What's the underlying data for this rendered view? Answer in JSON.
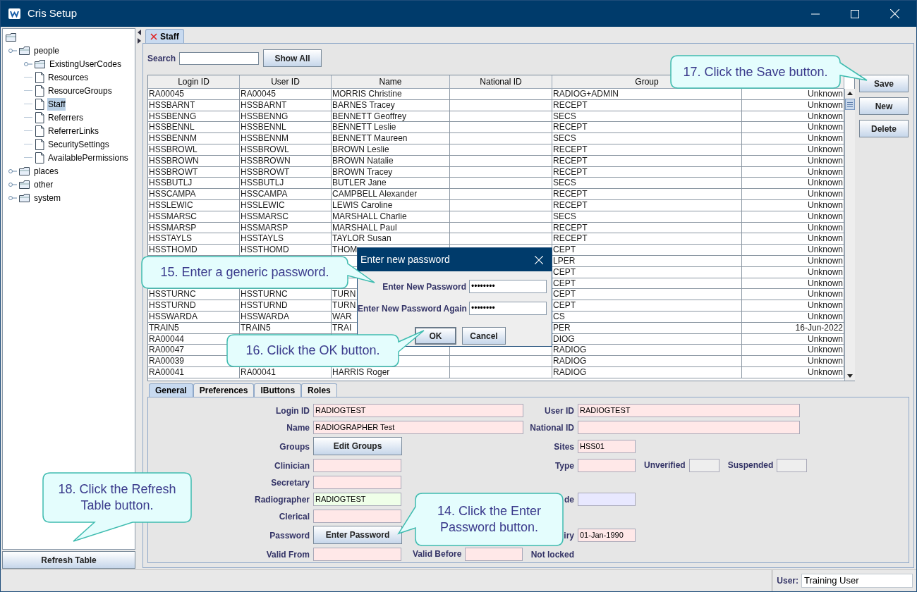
{
  "window": {
    "title": "Cris Setup"
  },
  "tree": {
    "kind": "folder",
    "children": [
      {
        "label": "people",
        "kind": "folder",
        "selected": false,
        "children": [
          {
            "label": "ExistingUserCodes",
            "kind": "folder",
            "selected": false
          },
          {
            "label": "Resources",
            "kind": "document",
            "selected": false
          },
          {
            "label": "ResourceGroups",
            "kind": "document",
            "selected": false
          },
          {
            "label": "Staff",
            "kind": "document",
            "selected": true
          },
          {
            "label": "Referrers",
            "kind": "document",
            "selected": false
          },
          {
            "label": "ReferrerLinks",
            "kind": "document",
            "selected": false
          },
          {
            "label": "SecuritySettings",
            "kind": "document",
            "selected": false
          },
          {
            "label": "AvailablePermissions",
            "kind": "document",
            "selected": false
          }
        ]
      },
      {
        "label": "places",
        "kind": "folder",
        "selected": false
      },
      {
        "label": "other",
        "kind": "folder",
        "selected": false
      },
      {
        "label": "system",
        "kind": "folder",
        "selected": false
      }
    ]
  },
  "refresh_button": "Refresh Table",
  "tabs": [
    {
      "label": "Staff",
      "selected": true
    }
  ],
  "search": {
    "label": "Search",
    "button": "Show All"
  },
  "table": {
    "columns": [
      {
        "label": "Login ID"
      },
      {
        "label": "User ID"
      },
      {
        "label": "Name"
      },
      {
        "label": "National ID"
      },
      {
        "label": "Group"
      }
    ],
    "rows": [
      {
        "login_id": "RA00045",
        "user_id": "RA00045",
        "name": "MORRIS Christine",
        "group": "RADIOG+ADMIN",
        "column_6": "Unknown"
      },
      {
        "login_id": "HSSBARNT",
        "user_id": "HSSBARNT",
        "name": "BARNES Tracey",
        "group": "RECEPT",
        "column_6": "Unknown"
      },
      {
        "login_id": "HSSBENNG",
        "user_id": "HSSBENNG",
        "name": "BENNETT Geoffrey",
        "group": "SECS",
        "column_6": "Unknown"
      },
      {
        "login_id": "HSSBENNL",
        "user_id": "HSSBENNL",
        "name": "BENNETT Leslie",
        "group": "RECEPT",
        "column_6": "Unknown"
      },
      {
        "login_id": "HSSBENNM",
        "user_id": "HSSBENNM",
        "name": "BENNETT Maureen",
        "group": "SECS",
        "column_6": "Unknown"
      },
      {
        "login_id": "HSSBROWL",
        "user_id": "HSSBROWL",
        "name": "BROWN Leslie",
        "group": "RECEPT",
        "column_6": "Unknown"
      },
      {
        "login_id": "HSSBROWN",
        "user_id": "HSSBROWN",
        "name": "BROWN Natalie",
        "group": "RECEPT",
        "column_6": "Unknown"
      },
      {
        "login_id": "HSSBROWT",
        "user_id": "HSSBROWT",
        "name": "BROWN Tracey",
        "group": "RECEPT",
        "column_6": "Unknown"
      },
      {
        "login_id": "HSSBUTLJ",
        "user_id": "HSSBUTLJ",
        "name": "BUTLER Jane",
        "group": "SECS",
        "column_6": "Unknown"
      },
      {
        "login_id": "HSSCAMPA",
        "user_id": "HSSCAMPA",
        "name": "CAMPBELL Alexander",
        "group": "RECEPT",
        "column_6": "Unknown"
      },
      {
        "login_id": "HSSLEWIC",
        "user_id": "HSSLEWIC",
        "name": "LEWIS Caroline",
        "group": "RECEPT",
        "column_6": "Unknown"
      },
      {
        "login_id": "HSSMARSC",
        "user_id": "HSSMARSC",
        "name": "MARSHALL Charlie",
        "group": "SECS",
        "column_6": "Unknown"
      },
      {
        "login_id": "HSSMARSP",
        "user_id": "HSSMARSP",
        "name": "MARSHALL Paul",
        "group": "RECEPT",
        "column_6": "Unknown"
      },
      {
        "login_id": "HSSTAYLS",
        "user_id": "HSSTAYLS",
        "name": "TAYLOR Susan",
        "group": "RECEPT",
        "column_6": "Unknown"
      },
      {
        "login_id": "HSSTHOMD",
        "user_id": "HSSTHOMD",
        "name": "THOM",
        "group": "CEPT",
        "column_6": "Unknown"
      },
      {
        "group": "LPER",
        "column_6": "Unknown"
      },
      {
        "group": "CEPT",
        "column_6": "Unknown"
      },
      {
        "group": "CEPT",
        "column_6": "Unknown"
      },
      {
        "login_id": "HSSTURNC",
        "user_id": "HSSTURNC",
        "name": "TURN",
        "group": "CEPT",
        "column_6": "Unknown"
      },
      {
        "login_id": "HSSTURND",
        "user_id": "HSSTURND",
        "name": "TURN",
        "group": "CEPT",
        "column_6": "Unknown"
      },
      {
        "login_id": "HSSWARDA",
        "user_id": "HSSWARDA",
        "name": "WAR",
        "group": "CS",
        "column_6": "Unknown"
      },
      {
        "login_id": "TRAIN5",
        "user_id": "TRAIN5",
        "name": "TRAI",
        "group": "PER",
        "column_6": "16-Jun-2022"
      },
      {
        "login_id": "RA00044",
        "group": "DIOG",
        "column_6": "Unknown"
      },
      {
        "login_id": "RA00047",
        "group": "RADIOG",
        "column_6": "Unknown"
      },
      {
        "login_id": "RA00039",
        "group": "RADIOG",
        "column_6": "Unknown"
      },
      {
        "login_id": "RA00041",
        "user_id": "RA00041",
        "name": "HARRIS Roger",
        "group": "RADIOG",
        "column_6": "Unknown"
      }
    ]
  },
  "side_buttons": [
    "Save",
    "New",
    "Delete"
  ],
  "form": {
    "tabs": [
      {
        "label": "General",
        "selected": true
      },
      {
        "label": "Preferences",
        "selected": false
      },
      {
        "label": "IButtons",
        "selected": false
      },
      {
        "label": "Roles",
        "selected": false
      }
    ],
    "rows": [
      {
        "left": [
          {
            "label": "Login ID",
            "kind": "wide_field",
            "value": "RADIOGTEST",
            "color": "#ffe8e8"
          }
        ],
        "right": [
          {
            "label": "User ID",
            "kind": "wide_field",
            "value": "RADIOGTEST",
            "color": "#ffe8e8"
          }
        ]
      },
      {
        "left": [
          {
            "label": "Name",
            "kind": "wide_field",
            "value": "RADIOGRAPHER Test",
            "color": "#ffe8e8"
          }
        ],
        "right": [
          {
            "label": "National ID",
            "kind": "wide_field",
            "color": "#ffe8e8"
          }
        ]
      },
      {
        "left": [
          {
            "label": "Groups",
            "kind": "button",
            "text": "Edit Groups"
          }
        ],
        "right": [
          {
            "label": "Sites",
            "kind": "field",
            "value": "HSS01",
            "color": "#ffe8e8"
          }
        ]
      },
      {
        "left": [
          {
            "label": "Clinician",
            "kind": "field",
            "color": "#ffe8e8"
          }
        ],
        "right": [
          {
            "label": "Type",
            "kind": "field",
            "color": "#ffe8e8"
          },
          {
            "label": "Unverified",
            "kind": "small_field",
            "color": "#eeeeee"
          },
          {
            "label": "Suspended",
            "kind": "small_field",
            "color": "#eeeeee"
          }
        ]
      },
      {
        "left": [
          {
            "label": "Secretary",
            "kind": "field",
            "color": "#ffe8e8"
          }
        ]
      },
      {
        "left": [
          {
            "label": "Radiographer",
            "kind": "field",
            "value": "RADIOGTEST",
            "color": "#efffe8"
          }
        ],
        "right": [
          {
            "label": "de",
            "kind": "field",
            "color": "#e8e8ff"
          }
        ]
      },
      {
        "left": [
          {
            "label": "Clerical",
            "kind": "field",
            "color": "#ffe8e8"
          }
        ]
      },
      {
        "left": [
          {
            "label": "Password",
            "kind": "button",
            "text": "Enter Password"
          }
        ],
        "right": [
          {
            "label": "iry",
            "kind": "field",
            "value": "01-Jan-1990",
            "color": "#ffe8e8"
          }
        ]
      },
      {
        "left": [
          {
            "label": "Valid From",
            "kind": "field",
            "color": "#ffe8e8"
          },
          {
            "label": "Valid Before",
            "kind": "field",
            "color": "#ffe8e8"
          }
        ],
        "right": [
          {
            "label": "Not locked",
            "kind": "text"
          }
        ]
      }
    ]
  },
  "status_bar": {
    "label": "User:",
    "value": "Training User"
  },
  "dialog": {
    "title": "Enter new password",
    "fields": [
      {
        "label": "Enter New Password",
        "value": "••••••••"
      },
      {
        "label": "Enter New Password Again",
        "value": "••••••••"
      }
    ],
    "buttons": [
      {
        "label": "OK",
        "default": true
      },
      {
        "label": "Cancel",
        "default": false
      }
    ]
  },
  "callouts": [
    {
      "text": "17. Click the Save button."
    },
    {
      "text": "15. Enter a generic password."
    },
    {
      "text": "16. Click the OK button."
    },
    {
      "text": "18. Click the Refresh Table button."
    },
    {
      "text": "14. Click the Enter Password button."
    }
  ]
}
